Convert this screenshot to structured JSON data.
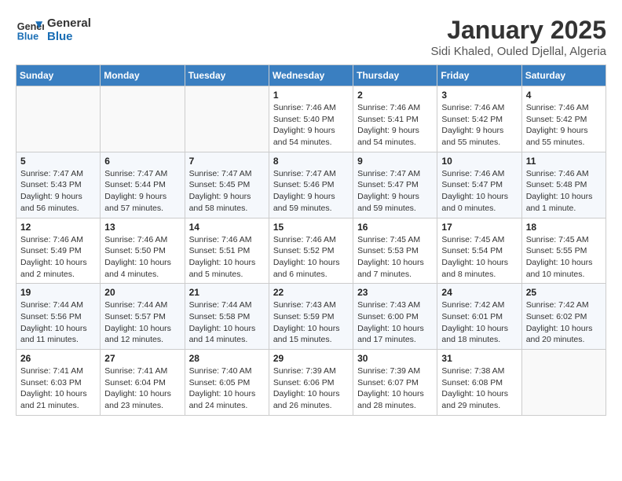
{
  "logo": {
    "line1": "General",
    "line2": "Blue"
  },
  "title": "January 2025",
  "subtitle": "Sidi Khaled, Ouled Djellal, Algeria",
  "days_of_week": [
    "Sunday",
    "Monday",
    "Tuesday",
    "Wednesday",
    "Thursday",
    "Friday",
    "Saturday"
  ],
  "weeks": [
    [
      {
        "day": "",
        "info": ""
      },
      {
        "day": "",
        "info": ""
      },
      {
        "day": "",
        "info": ""
      },
      {
        "day": "1",
        "info": "Sunrise: 7:46 AM\nSunset: 5:40 PM\nDaylight: 9 hours\nand 54 minutes."
      },
      {
        "day": "2",
        "info": "Sunrise: 7:46 AM\nSunset: 5:41 PM\nDaylight: 9 hours\nand 54 minutes."
      },
      {
        "day": "3",
        "info": "Sunrise: 7:46 AM\nSunset: 5:42 PM\nDaylight: 9 hours\nand 55 minutes."
      },
      {
        "day": "4",
        "info": "Sunrise: 7:46 AM\nSunset: 5:42 PM\nDaylight: 9 hours\nand 55 minutes."
      }
    ],
    [
      {
        "day": "5",
        "info": "Sunrise: 7:47 AM\nSunset: 5:43 PM\nDaylight: 9 hours\nand 56 minutes."
      },
      {
        "day": "6",
        "info": "Sunrise: 7:47 AM\nSunset: 5:44 PM\nDaylight: 9 hours\nand 57 minutes."
      },
      {
        "day": "7",
        "info": "Sunrise: 7:47 AM\nSunset: 5:45 PM\nDaylight: 9 hours\nand 58 minutes."
      },
      {
        "day": "8",
        "info": "Sunrise: 7:47 AM\nSunset: 5:46 PM\nDaylight: 9 hours\nand 59 minutes."
      },
      {
        "day": "9",
        "info": "Sunrise: 7:47 AM\nSunset: 5:47 PM\nDaylight: 9 hours\nand 59 minutes."
      },
      {
        "day": "10",
        "info": "Sunrise: 7:46 AM\nSunset: 5:47 PM\nDaylight: 10 hours\nand 0 minutes."
      },
      {
        "day": "11",
        "info": "Sunrise: 7:46 AM\nSunset: 5:48 PM\nDaylight: 10 hours\nand 1 minute."
      }
    ],
    [
      {
        "day": "12",
        "info": "Sunrise: 7:46 AM\nSunset: 5:49 PM\nDaylight: 10 hours\nand 2 minutes."
      },
      {
        "day": "13",
        "info": "Sunrise: 7:46 AM\nSunset: 5:50 PM\nDaylight: 10 hours\nand 4 minutes."
      },
      {
        "day": "14",
        "info": "Sunrise: 7:46 AM\nSunset: 5:51 PM\nDaylight: 10 hours\nand 5 minutes."
      },
      {
        "day": "15",
        "info": "Sunrise: 7:46 AM\nSunset: 5:52 PM\nDaylight: 10 hours\nand 6 minutes."
      },
      {
        "day": "16",
        "info": "Sunrise: 7:45 AM\nSunset: 5:53 PM\nDaylight: 10 hours\nand 7 minutes."
      },
      {
        "day": "17",
        "info": "Sunrise: 7:45 AM\nSunset: 5:54 PM\nDaylight: 10 hours\nand 8 minutes."
      },
      {
        "day": "18",
        "info": "Sunrise: 7:45 AM\nSunset: 5:55 PM\nDaylight: 10 hours\nand 10 minutes."
      }
    ],
    [
      {
        "day": "19",
        "info": "Sunrise: 7:44 AM\nSunset: 5:56 PM\nDaylight: 10 hours\nand 11 minutes."
      },
      {
        "day": "20",
        "info": "Sunrise: 7:44 AM\nSunset: 5:57 PM\nDaylight: 10 hours\nand 12 minutes."
      },
      {
        "day": "21",
        "info": "Sunrise: 7:44 AM\nSunset: 5:58 PM\nDaylight: 10 hours\nand 14 minutes."
      },
      {
        "day": "22",
        "info": "Sunrise: 7:43 AM\nSunset: 5:59 PM\nDaylight: 10 hours\nand 15 minutes."
      },
      {
        "day": "23",
        "info": "Sunrise: 7:43 AM\nSunset: 6:00 PM\nDaylight: 10 hours\nand 17 minutes."
      },
      {
        "day": "24",
        "info": "Sunrise: 7:42 AM\nSunset: 6:01 PM\nDaylight: 10 hours\nand 18 minutes."
      },
      {
        "day": "25",
        "info": "Sunrise: 7:42 AM\nSunset: 6:02 PM\nDaylight: 10 hours\nand 20 minutes."
      }
    ],
    [
      {
        "day": "26",
        "info": "Sunrise: 7:41 AM\nSunset: 6:03 PM\nDaylight: 10 hours\nand 21 minutes."
      },
      {
        "day": "27",
        "info": "Sunrise: 7:41 AM\nSunset: 6:04 PM\nDaylight: 10 hours\nand 23 minutes."
      },
      {
        "day": "28",
        "info": "Sunrise: 7:40 AM\nSunset: 6:05 PM\nDaylight: 10 hours\nand 24 minutes."
      },
      {
        "day": "29",
        "info": "Sunrise: 7:39 AM\nSunset: 6:06 PM\nDaylight: 10 hours\nand 26 minutes."
      },
      {
        "day": "30",
        "info": "Sunrise: 7:39 AM\nSunset: 6:07 PM\nDaylight: 10 hours\nand 28 minutes."
      },
      {
        "day": "31",
        "info": "Sunrise: 7:38 AM\nSunset: 6:08 PM\nDaylight: 10 hours\nand 29 minutes."
      },
      {
        "day": "",
        "info": ""
      }
    ]
  ]
}
